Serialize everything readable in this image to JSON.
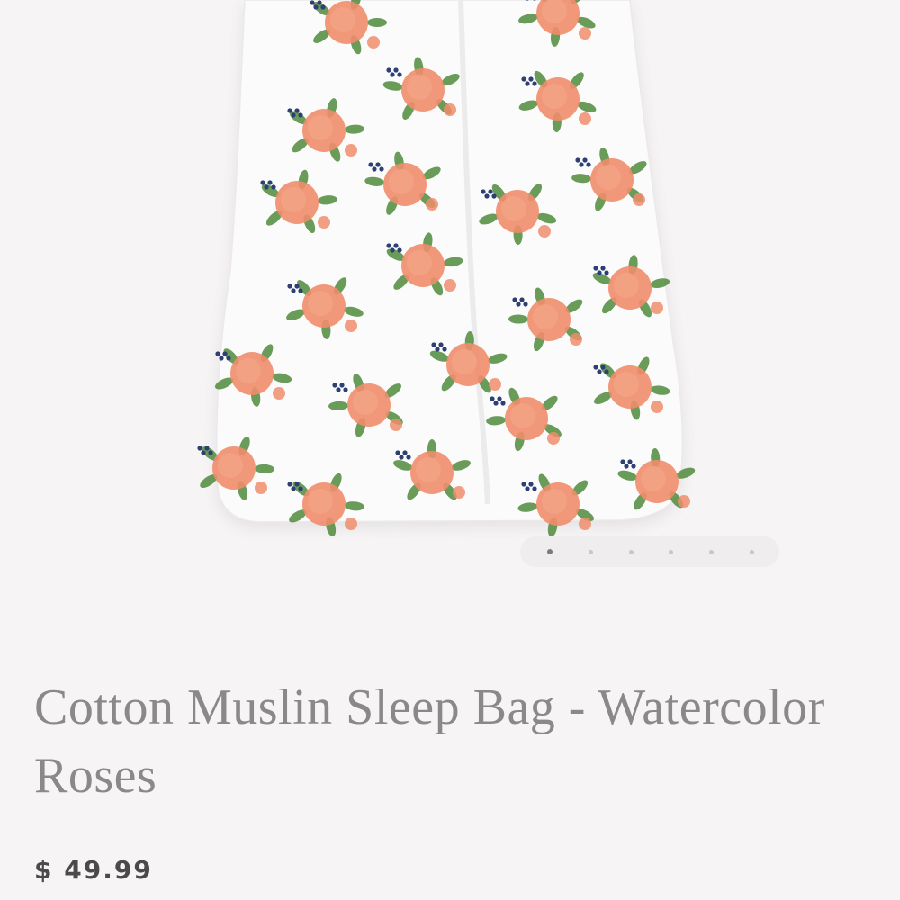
{
  "product": {
    "title": "Cotton Muslin Sleep Bag - Watercolor Roses",
    "price": "$ 49.99"
  },
  "gallery": {
    "image_count": 6,
    "active_index": 0
  },
  "colors": {
    "background": "#f6f4f5",
    "title_text": "#8a8889",
    "price_text": "#4b494a",
    "rose": "#f08d6c",
    "leaf": "#4f8a3c",
    "berry": "#2e3f73"
  }
}
